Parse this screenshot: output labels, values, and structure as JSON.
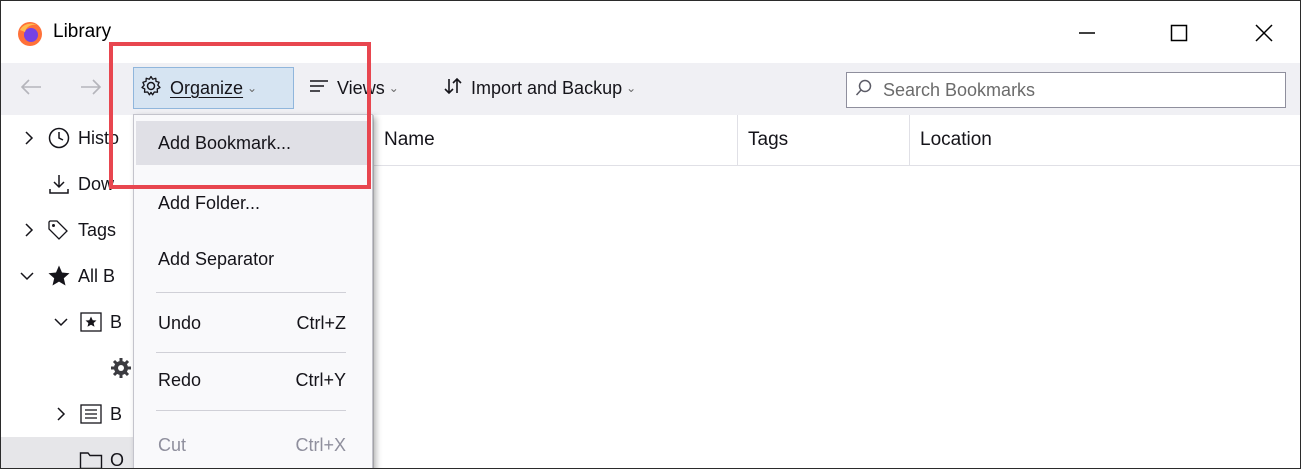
{
  "window": {
    "title": "Library",
    "app_icon": "firefox-icon",
    "controls": [
      "minimize-icon",
      "maximize-icon",
      "close-icon"
    ]
  },
  "toolbar": {
    "back_icon": "arrow-left-icon",
    "forward_icon": "arrow-right-icon",
    "organize": {
      "icon": "gear-icon",
      "label": "Organize"
    },
    "views": {
      "icon": "list-icon",
      "label": "Views"
    },
    "import": {
      "icon": "sort-arrows-icon",
      "label": "Import and Backup"
    },
    "search": {
      "icon": "search-icon",
      "placeholder": "Search Bookmarks",
      "value": ""
    }
  },
  "tree": {
    "items": [
      {
        "label": "Histo",
        "icon": "clock-icon",
        "twisty": "collapsed"
      },
      {
        "label": "Dow",
        "icon": "download-icon",
        "twisty": "none"
      },
      {
        "label": "Tags",
        "icon": "tag-icon",
        "twisty": "collapsed"
      },
      {
        "label": "All B",
        "icon": "star-icon",
        "twisty": "expanded"
      },
      {
        "label": "B",
        "icon": "bookmark-toolbar-icon",
        "twisty": "expanded"
      },
      {
        "label": "",
        "icon": "gear-icon",
        "twisty": "none"
      },
      {
        "label": "B",
        "icon": "bookmark-menu-icon",
        "twisty": "collapsed"
      },
      {
        "label": "O",
        "icon": "folder-icon",
        "twisty": "none",
        "selected": true
      }
    ]
  },
  "table": {
    "columns": [
      "Name",
      "Tags",
      "Location"
    ]
  },
  "menu": {
    "items": [
      {
        "label": "Add Bookmark...",
        "shortcut": "",
        "hover": true
      },
      {
        "label": "Add Folder...",
        "shortcut": ""
      },
      {
        "label": "Add Separator",
        "shortcut": ""
      },
      {
        "separator": true
      },
      {
        "label": "Undo",
        "shortcut": "Ctrl+Z"
      },
      {
        "separator": true
      },
      {
        "label": "Redo",
        "shortcut": "Ctrl+Y"
      },
      {
        "separator": true
      },
      {
        "label": "Cut",
        "shortcut": "Ctrl+X",
        "disabled": true
      }
    ]
  },
  "colors": {
    "annotation": "#e8464f",
    "toolbar_bg": "#f0f0f4",
    "organize_active": "#d6e4f2",
    "menu_hover": "#e0e0e6"
  }
}
